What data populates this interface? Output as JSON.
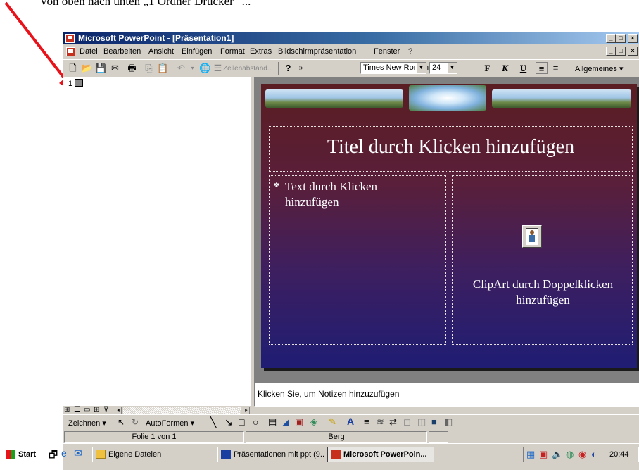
{
  "caption": "von oben nach unten „1 Ordner Drucker“ ...",
  "window": {
    "title": "Microsoft PowerPoint - [Präsentation1]",
    "buttons": [
      "_",
      "□",
      "×"
    ]
  },
  "menu": {
    "items": [
      "Datei",
      "Bearbeiten",
      "Ansicht",
      "Einfügen",
      "Format",
      "Extras",
      "Bildschirmpräsentation",
      "Fenster",
      "?"
    ]
  },
  "toolbar": {
    "line_spacing_label": "Zeilenabstand...",
    "font_name": "Times New Roman",
    "font_size": "24",
    "bold": "F",
    "italic": "K",
    "underline": "U",
    "general": "Allgemeines"
  },
  "outline": {
    "slide_number": "1"
  },
  "slide": {
    "title": "Titel durch Klicken hinzufügen",
    "text_bullet": "❖",
    "text_placeholder": "Text durch Klicken hinzufügen",
    "clipart_placeholder": "ClipArt durch Doppelklicken hinzufügen"
  },
  "notes": {
    "placeholder": "Klicken Sie, um Notizen hinzuzufügen"
  },
  "drawing_toolbar": {
    "draw": "Zeichnen",
    "autoshapes": "AutoFormen"
  },
  "status": {
    "slide_of": "Folie 1 von 1",
    "design": "Berg"
  },
  "taskbar": {
    "start": "Start",
    "tasks": [
      {
        "label": "Eigene Dateien"
      },
      {
        "label": "Präsentationen mit ppt (9..."
      },
      {
        "label": "Microsoft PowerPoin..."
      }
    ],
    "clock": "20:44"
  },
  "colors": {
    "titlebar": "#0a246a",
    "slide_top": "#5a1d22",
    "slide_bottom": "#1f1d74",
    "arrow": "#e8121a"
  }
}
